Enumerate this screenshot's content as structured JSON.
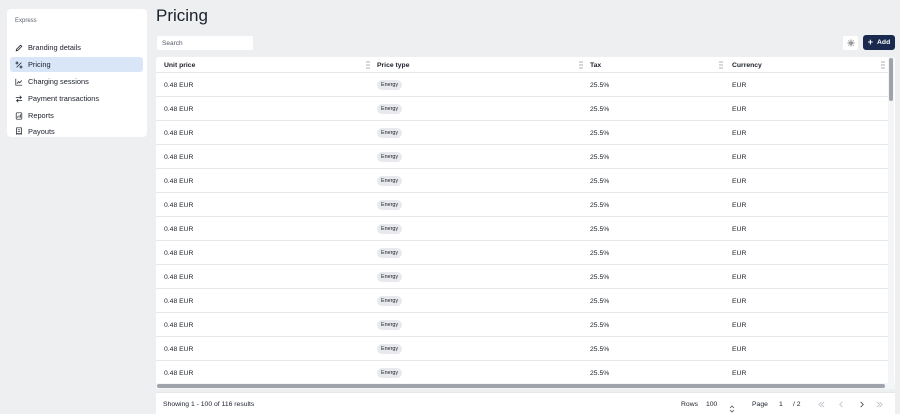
{
  "sidebar": {
    "section_label": "Express",
    "items": [
      {
        "label": "Branding details",
        "icon": "pencil-icon",
        "active": false
      },
      {
        "label": "Pricing",
        "icon": "percent-icon",
        "active": true
      },
      {
        "label": "Charging sessions",
        "icon": "chart-line-icon",
        "active": false
      },
      {
        "label": "Payment transactions",
        "icon": "transfer-arrows-icon",
        "active": false
      },
      {
        "label": "Reports",
        "icon": "report-icon",
        "active": false
      },
      {
        "label": "Payouts",
        "icon": "receipt-icon",
        "active": false
      }
    ]
  },
  "header": {
    "title": "Pricing",
    "search_placeholder": "Search",
    "add_label": "Add"
  },
  "table": {
    "columns": [
      "Unit price",
      "Price type",
      "Tax",
      "Currency"
    ],
    "rows": [
      {
        "unit_price": "0.48 EUR",
        "price_type": "Energy",
        "tax": "25.5%",
        "currency": "EUR"
      },
      {
        "unit_price": "0.48 EUR",
        "price_type": "Energy",
        "tax": "25.5%",
        "currency": "EUR"
      },
      {
        "unit_price": "0.48 EUR",
        "price_type": "Energy",
        "tax": "25.5%",
        "currency": "EUR"
      },
      {
        "unit_price": "0.48 EUR",
        "price_type": "Energy",
        "tax": "25.5%",
        "currency": "EUR"
      },
      {
        "unit_price": "0.48 EUR",
        "price_type": "Energy",
        "tax": "25.5%",
        "currency": "EUR"
      },
      {
        "unit_price": "0.48 EUR",
        "price_type": "Energy",
        "tax": "25.5%",
        "currency": "EUR"
      },
      {
        "unit_price": "0.48 EUR",
        "price_type": "Energy",
        "tax": "25.5%",
        "currency": "EUR"
      },
      {
        "unit_price": "0.48 EUR",
        "price_type": "Energy",
        "tax": "25.5%",
        "currency": "EUR"
      },
      {
        "unit_price": "0.48 EUR",
        "price_type": "Energy",
        "tax": "25.5%",
        "currency": "EUR"
      },
      {
        "unit_price": "0.48 EUR",
        "price_type": "Energy",
        "tax": "25.5%",
        "currency": "EUR"
      },
      {
        "unit_price": "0.48 EUR",
        "price_type": "Energy",
        "tax": "25.5%",
        "currency": "EUR"
      },
      {
        "unit_price": "0.48 EUR",
        "price_type": "Energy",
        "tax": "25.5%",
        "currency": "EUR"
      },
      {
        "unit_price": "0.48 EUR",
        "price_type": "Energy",
        "tax": "25.5%",
        "currency": "EUR"
      }
    ]
  },
  "footer": {
    "results_text": "Showing 1 - 100 of 116 results",
    "rows_label": "Rows",
    "rows_value": "100",
    "page_label": "Page",
    "page_value": "1",
    "page_total": "/ 2"
  },
  "colors": {
    "background": "#eeeff1",
    "active_nav": "#d8e6f8",
    "primary_button": "#1a2a4f",
    "badge": "#e7e9ed"
  }
}
